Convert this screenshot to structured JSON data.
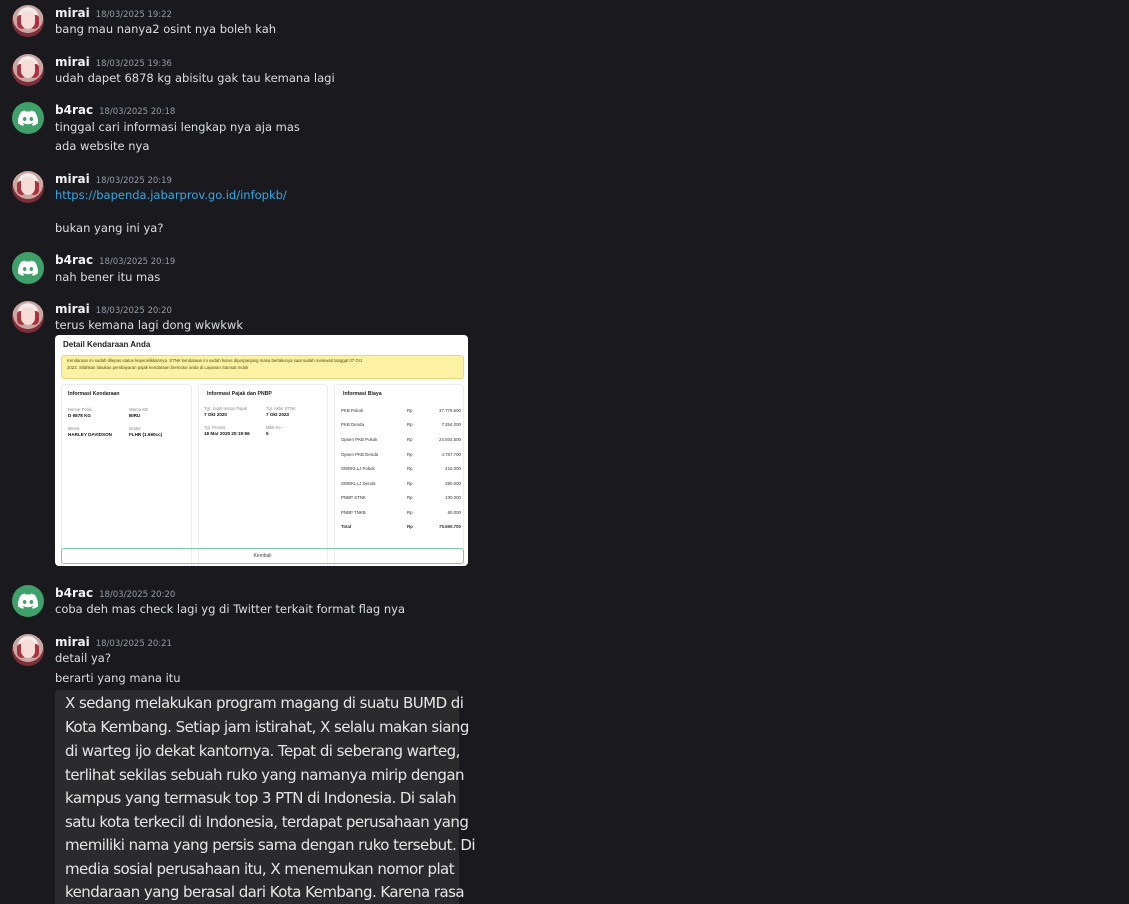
{
  "messages": [
    {
      "author": "mirai",
      "time": "18/03/2025 19:22",
      "lines": [
        "bang mau nanya2 osint nya boleh kah"
      ]
    },
    {
      "author": "mirai",
      "time": "18/03/2025 19:36",
      "lines": [
        "udah dapet 6878 kg abisitu gak tau kemana lagi"
      ]
    },
    {
      "author": "b4rac",
      "time": "18/03/2025 20:18",
      "lines": [
        "tinggal cari informasi lengkap nya aja mas",
        "ada website nya"
      ]
    },
    {
      "author": "mirai",
      "time": "18/03/2025 20:19",
      "link": "https://bapenda.jabarprov.go.id/infopkb/",
      "lines": [
        "bukan yang ini ya?"
      ]
    },
    {
      "author": "b4rac",
      "time": "18/03/2025 20:19",
      "lines": [
        "nah bener itu mas"
      ]
    },
    {
      "author": "mirai",
      "time": "18/03/2025 20:20",
      "lines": [
        "terus kemana lagi dong wkwkwk"
      ]
    },
    {
      "author": "b4rac",
      "time": "18/03/2025 20:20",
      "lines": [
        "coba deh mas check lagi yg di Twitter terkait format flag nya"
      ]
    },
    {
      "author": "mirai",
      "time": "18/03/2025 20:21",
      "lines": [
        "detail ya?",
        "berarti yang mana itu"
      ]
    }
  ],
  "embed": {
    "title": "Detail Kendaraan Anda",
    "warning_line1": "Kendaraan ini sudah dilepas status kepemilikkannya. STNK kendaraan ini sudah harus diperpanjang masa berlakunya saat sudah melewati tanggal 07 Oct",
    "warning_line2": "2023. Silahkan lakukan pembayaran pajak kendaraan bermotor anda di Layanan Samsat Induk",
    "kendaraan": {
      "title": "Informasi Kendaraan",
      "nopol_label": "Nomor Polisi",
      "nopol": "D 6878 KG",
      "warna_label": "Warna KB",
      "warna": "BIRU",
      "merek_label": "Merek",
      "merek": "HARLEY DAVIDSON",
      "model_label": "Model",
      "model": "FLHR (1.690cc)"
    },
    "pajak": {
      "title": "Informasi Pajak dan PNBP",
      "jatuh_label": "Tgl. Jatuh tempo Pajak",
      "jatuh": "7 Okt 2020",
      "akhir_label": "Tgl. Akhir STNK",
      "akhir": "7 Okt 2023",
      "proses_label": "Tgl. Proses",
      "proses": "18 Mar 2025 20:19:56",
      "milik_label": "Milik Ke -",
      "milik": "5"
    },
    "biaya": {
      "title": "Informasi Biaya",
      "rows": [
        {
          "label": "PKB Pokok",
          "rp": "Rp",
          "amount": "37.779.500"
        },
        {
          "label": "PKB Denda",
          "rp": "Rp",
          "amount": "7.254.000"
        },
        {
          "label": "Opsen PKB Pokok",
          "rp": "Rp",
          "amount": "24.934.500"
        },
        {
          "label": "Opsen PKB Denda",
          "rp": "Rp",
          "amount": "4.787.700"
        },
        {
          "label": "SWDKLLJ Pokok",
          "rp": "Rp",
          "amount": "415.000"
        },
        {
          "label": "SWDKLLJ Denda",
          "rp": "Rp",
          "amount": "360.000"
        },
        {
          "label": "PNBP STNK",
          "rp": "Rp",
          "amount": "100.000"
        },
        {
          "label": "PNBP TNKB",
          "rp": "Rp",
          "amount": "60.000"
        },
        {
          "label": "Total",
          "rp": "Rp",
          "amount": "75.690.700"
        }
      ]
    },
    "button": "Kembali"
  },
  "quote_lines": [
    "X sedang melakukan program magang di suatu BUMD di",
    "Kota Kembang. Setiap jam istirahat, X selalu makan siang",
    "di warteg ijo dekat kantornya. Tepat di seberang warteg,",
    "terlihat sekilas sebuah ruko yang namanya mirip dengan",
    "kampus yang termasuk top 3 PTN di Indonesia. Di salah",
    "satu kota terkecil di Indonesia, terdapat perusahaan yang",
    "memiliki nama yang persis sama dengan ruko tersebut. Di",
    "media sosial perusahaan itu, X menemukan nomor plat",
    "kendaraan yang berasal dari Kota Kembang. Karena rasa"
  ]
}
